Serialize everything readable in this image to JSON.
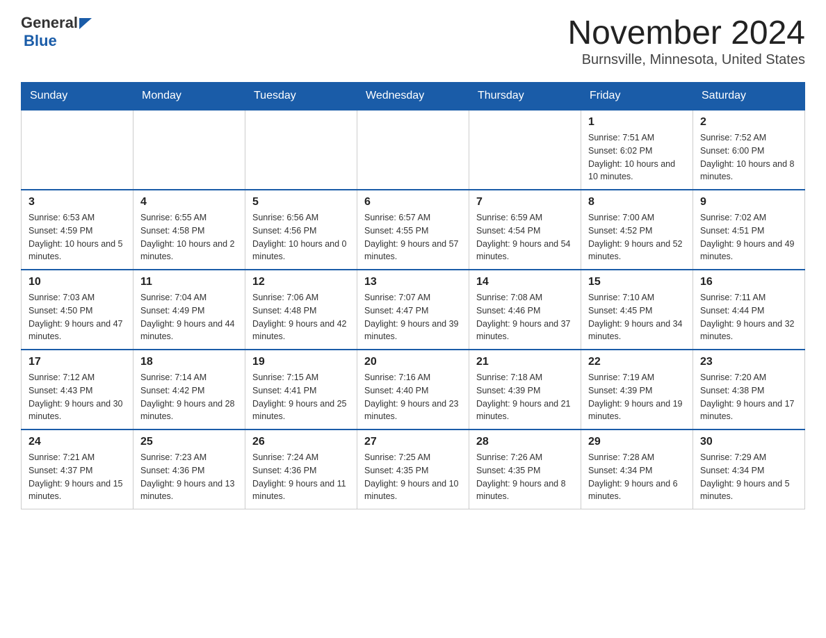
{
  "header": {
    "logo": {
      "general": "General",
      "blue": "Blue"
    },
    "title": "November 2024",
    "subtitle": "Burnsville, Minnesota, United States"
  },
  "calendar": {
    "headers": [
      "Sunday",
      "Monday",
      "Tuesday",
      "Wednesday",
      "Thursday",
      "Friday",
      "Saturday"
    ],
    "weeks": [
      {
        "days": [
          {
            "number": "",
            "info": "",
            "empty": true
          },
          {
            "number": "",
            "info": "",
            "empty": true
          },
          {
            "number": "",
            "info": "",
            "empty": true
          },
          {
            "number": "",
            "info": "",
            "empty": true
          },
          {
            "number": "",
            "info": "",
            "empty": true
          },
          {
            "number": "1",
            "info": "Sunrise: 7:51 AM\nSunset: 6:02 PM\nDaylight: 10 hours and 10 minutes.",
            "empty": false
          },
          {
            "number": "2",
            "info": "Sunrise: 7:52 AM\nSunset: 6:00 PM\nDaylight: 10 hours and 8 minutes.",
            "empty": false
          }
        ]
      },
      {
        "days": [
          {
            "number": "3",
            "info": "Sunrise: 6:53 AM\nSunset: 4:59 PM\nDaylight: 10 hours and 5 minutes.",
            "empty": false
          },
          {
            "number": "4",
            "info": "Sunrise: 6:55 AM\nSunset: 4:58 PM\nDaylight: 10 hours and 2 minutes.",
            "empty": false
          },
          {
            "number": "5",
            "info": "Sunrise: 6:56 AM\nSunset: 4:56 PM\nDaylight: 10 hours and 0 minutes.",
            "empty": false
          },
          {
            "number": "6",
            "info": "Sunrise: 6:57 AM\nSunset: 4:55 PM\nDaylight: 9 hours and 57 minutes.",
            "empty": false
          },
          {
            "number": "7",
            "info": "Sunrise: 6:59 AM\nSunset: 4:54 PM\nDaylight: 9 hours and 54 minutes.",
            "empty": false
          },
          {
            "number": "8",
            "info": "Sunrise: 7:00 AM\nSunset: 4:52 PM\nDaylight: 9 hours and 52 minutes.",
            "empty": false
          },
          {
            "number": "9",
            "info": "Sunrise: 7:02 AM\nSunset: 4:51 PM\nDaylight: 9 hours and 49 minutes.",
            "empty": false
          }
        ]
      },
      {
        "days": [
          {
            "number": "10",
            "info": "Sunrise: 7:03 AM\nSunset: 4:50 PM\nDaylight: 9 hours and 47 minutes.",
            "empty": false
          },
          {
            "number": "11",
            "info": "Sunrise: 7:04 AM\nSunset: 4:49 PM\nDaylight: 9 hours and 44 minutes.",
            "empty": false
          },
          {
            "number": "12",
            "info": "Sunrise: 7:06 AM\nSunset: 4:48 PM\nDaylight: 9 hours and 42 minutes.",
            "empty": false
          },
          {
            "number": "13",
            "info": "Sunrise: 7:07 AM\nSunset: 4:47 PM\nDaylight: 9 hours and 39 minutes.",
            "empty": false
          },
          {
            "number": "14",
            "info": "Sunrise: 7:08 AM\nSunset: 4:46 PM\nDaylight: 9 hours and 37 minutes.",
            "empty": false
          },
          {
            "number": "15",
            "info": "Sunrise: 7:10 AM\nSunset: 4:45 PM\nDaylight: 9 hours and 34 minutes.",
            "empty": false
          },
          {
            "number": "16",
            "info": "Sunrise: 7:11 AM\nSunset: 4:44 PM\nDaylight: 9 hours and 32 minutes.",
            "empty": false
          }
        ]
      },
      {
        "days": [
          {
            "number": "17",
            "info": "Sunrise: 7:12 AM\nSunset: 4:43 PM\nDaylight: 9 hours and 30 minutes.",
            "empty": false
          },
          {
            "number": "18",
            "info": "Sunrise: 7:14 AM\nSunset: 4:42 PM\nDaylight: 9 hours and 28 minutes.",
            "empty": false
          },
          {
            "number": "19",
            "info": "Sunrise: 7:15 AM\nSunset: 4:41 PM\nDaylight: 9 hours and 25 minutes.",
            "empty": false
          },
          {
            "number": "20",
            "info": "Sunrise: 7:16 AM\nSunset: 4:40 PM\nDaylight: 9 hours and 23 minutes.",
            "empty": false
          },
          {
            "number": "21",
            "info": "Sunrise: 7:18 AM\nSunset: 4:39 PM\nDaylight: 9 hours and 21 minutes.",
            "empty": false
          },
          {
            "number": "22",
            "info": "Sunrise: 7:19 AM\nSunset: 4:39 PM\nDaylight: 9 hours and 19 minutes.",
            "empty": false
          },
          {
            "number": "23",
            "info": "Sunrise: 7:20 AM\nSunset: 4:38 PM\nDaylight: 9 hours and 17 minutes.",
            "empty": false
          }
        ]
      },
      {
        "days": [
          {
            "number": "24",
            "info": "Sunrise: 7:21 AM\nSunset: 4:37 PM\nDaylight: 9 hours and 15 minutes.",
            "empty": false
          },
          {
            "number": "25",
            "info": "Sunrise: 7:23 AM\nSunset: 4:36 PM\nDaylight: 9 hours and 13 minutes.",
            "empty": false
          },
          {
            "number": "26",
            "info": "Sunrise: 7:24 AM\nSunset: 4:36 PM\nDaylight: 9 hours and 11 minutes.",
            "empty": false
          },
          {
            "number": "27",
            "info": "Sunrise: 7:25 AM\nSunset: 4:35 PM\nDaylight: 9 hours and 10 minutes.",
            "empty": false
          },
          {
            "number": "28",
            "info": "Sunrise: 7:26 AM\nSunset: 4:35 PM\nDaylight: 9 hours and 8 minutes.",
            "empty": false
          },
          {
            "number": "29",
            "info": "Sunrise: 7:28 AM\nSunset: 4:34 PM\nDaylight: 9 hours and 6 minutes.",
            "empty": false
          },
          {
            "number": "30",
            "info": "Sunrise: 7:29 AM\nSunset: 4:34 PM\nDaylight: 9 hours and 5 minutes.",
            "empty": false
          }
        ]
      }
    ]
  }
}
